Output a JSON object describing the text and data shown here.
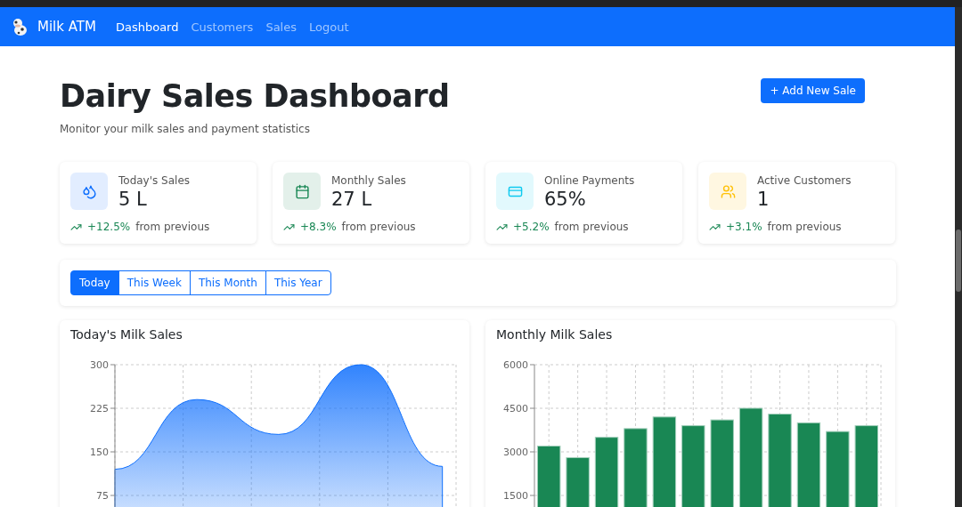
{
  "navbar": {
    "brand": "Milk ATM",
    "links": [
      {
        "label": "Dashboard",
        "selected": true
      },
      {
        "label": "Customers",
        "selected": false
      },
      {
        "label": "Sales",
        "selected": false
      },
      {
        "label": "Logout",
        "selected": false
      }
    ]
  },
  "header": {
    "title": "Dairy Sales Dashboard",
    "subtitle": "Monitor your milk sales and payment statistics",
    "button": "+ Add New Sale"
  },
  "stats": [
    {
      "kind": "droplets",
      "label": "Today's Sales",
      "value": "5 L",
      "change": "+12.5%",
      "note": "from previous",
      "color": "#0d6efd"
    },
    {
      "kind": "calendar",
      "label": "Monthly Sales",
      "value": "27 L",
      "change": "+8.3%",
      "note": "from previous",
      "color": "#198754"
    },
    {
      "kind": "card",
      "label": "Online Payments",
      "value": "65%",
      "change": "+5.2%",
      "note": "from previous",
      "color": "#0dcaf0"
    },
    {
      "kind": "users",
      "label": "Active Customers",
      "value": "1",
      "change": "+3.1%",
      "note": "from previous",
      "color": "#ffc107"
    }
  ],
  "periods": [
    {
      "label": "Today",
      "selected": true
    },
    {
      "label": "This Week",
      "selected": false
    },
    {
      "label": "This Month",
      "selected": false
    },
    {
      "label": "This Year",
      "selected": false
    }
  ],
  "charts": [
    {
      "title": "Today's Milk Sales",
      "chart_data": {
        "type": "area",
        "grid": true,
        "series": [
          {
            "color": "#0d6efd",
            "values": [
              120,
              240,
              180,
              300,
              125
            ]
          }
        ],
        "ylim": [
          0,
          300
        ],
        "yticks": [
          75,
          150,
          225,
          300
        ]
      }
    },
    {
      "title": "Monthly Milk Sales",
      "chart_data": {
        "type": "bar",
        "grid": true,
        "series": [
          {
            "color": "#198754",
            "values": [
              3200,
              2800,
              3500,
              3800,
              4200,
              3900,
              4100,
              4500,
              4300,
              4000,
              3700,
              3900
            ]
          }
        ],
        "ylim": [
          0,
          6000
        ],
        "yticks": [
          1500,
          3000,
          4500,
          6000
        ]
      }
    }
  ]
}
